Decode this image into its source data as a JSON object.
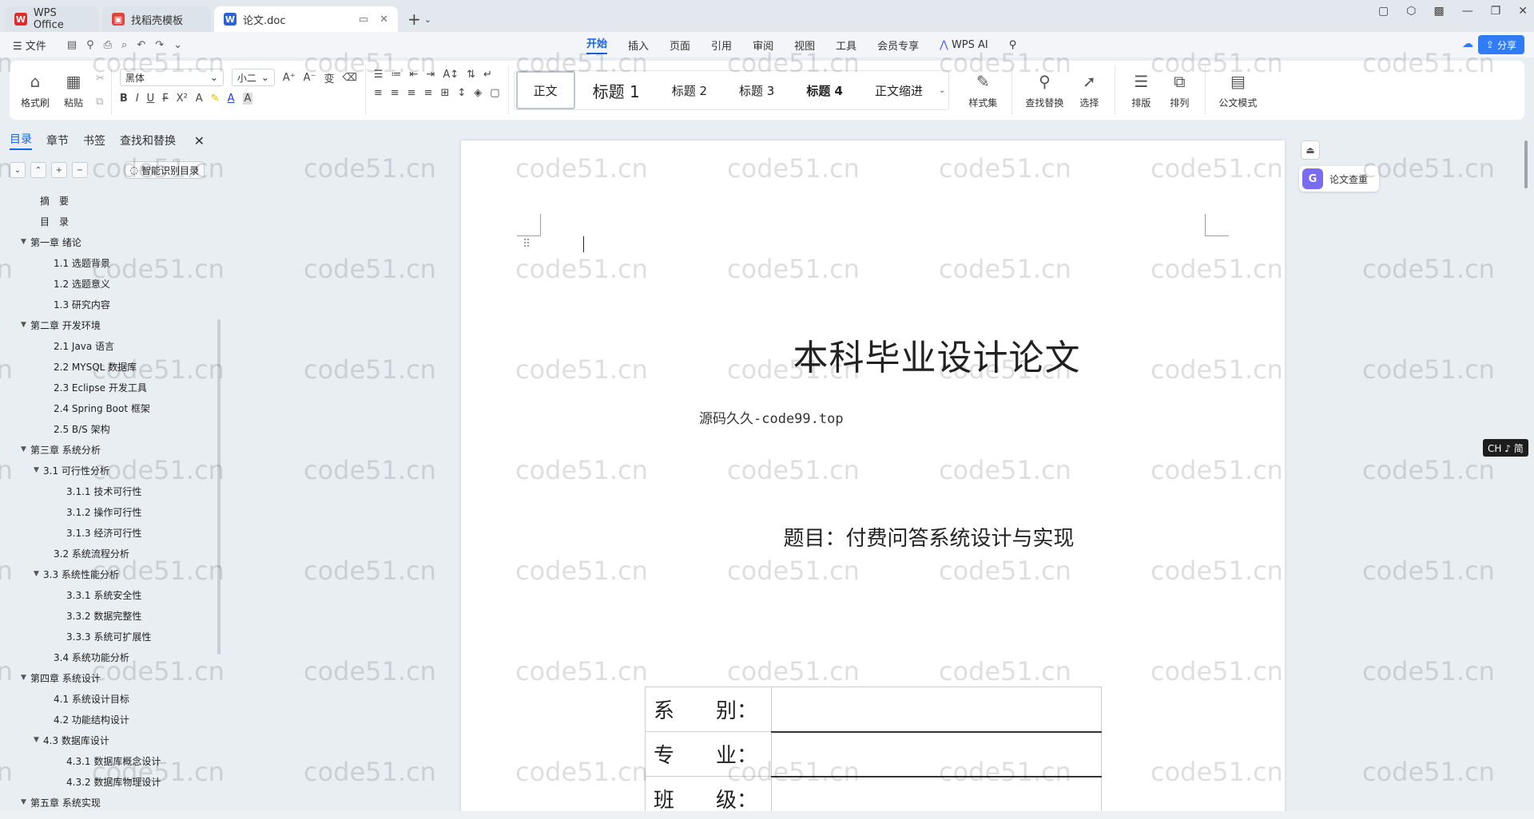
{
  "tabs": [
    {
      "label": "WPS Office"
    },
    {
      "label": "找稻壳模板"
    },
    {
      "label": "论文.doc"
    }
  ],
  "menu": {
    "file": "文件",
    "items": [
      "开始",
      "插入",
      "页面",
      "引用",
      "审阅",
      "视图",
      "工具",
      "会员专享"
    ],
    "wps_ai": "WPS AI",
    "share": "分享"
  },
  "ribbon": {
    "format_painter": "格式刷",
    "paste": "粘贴",
    "font_name": "黑体",
    "font_size": "小二",
    "styles": [
      "正文",
      "标题 1",
      "标题 2",
      "标题 3",
      "标题 4",
      "正文缩进"
    ],
    "style_set": "样式集",
    "find_replace": "查找替换",
    "select": "选择",
    "layout": "排版",
    "arrange": "排列",
    "official_mode": "公文模式"
  },
  "sidebar": {
    "tabs": [
      "目录",
      "章节",
      "书签",
      "查找和替换"
    ],
    "smart_toc": "智能识别目录",
    "toc": [
      {
        "label": "摘　要",
        "level": "lv0",
        "arrow": ""
      },
      {
        "label": "目　录",
        "level": "lv0",
        "arrow": ""
      },
      {
        "label": "第一章 绪论",
        "level": "lv1",
        "arrow": "▼"
      },
      {
        "label": "1.1 选题背景",
        "level": "lv2",
        "arrow": ""
      },
      {
        "label": "1.2 选题意义",
        "level": "lv2",
        "arrow": ""
      },
      {
        "label": "1.3 研究内容",
        "level": "lv2",
        "arrow": ""
      },
      {
        "label": "第二章 开发环境",
        "level": "lv1",
        "arrow": "▼"
      },
      {
        "label": "2.1 Java 语言",
        "level": "lv2",
        "arrow": ""
      },
      {
        "label": "2.2 MYSQL 数据库",
        "level": "lv2",
        "arrow": ""
      },
      {
        "label": "2.3 Eclipse 开发工具",
        "level": "lv2",
        "arrow": ""
      },
      {
        "label": "2.4 Spring Boot 框架",
        "level": "lv2",
        "arrow": ""
      },
      {
        "label": "2.5 B/S 架构",
        "level": "lv2",
        "arrow": ""
      },
      {
        "label": "第三章 系统分析",
        "level": "lv1",
        "arrow": "▼"
      },
      {
        "label": "3.1 可行性分析",
        "level": "lv2a",
        "arrow": "▼"
      },
      {
        "label": "3.1.1 技术可行性",
        "level": "lv3",
        "arrow": ""
      },
      {
        "label": "3.1.2 操作可行性",
        "level": "lv3",
        "arrow": ""
      },
      {
        "label": "3.1.3 经济可行性",
        "level": "lv3",
        "arrow": ""
      },
      {
        "label": "3.2 系统流程分析",
        "level": "lv2",
        "arrow": ""
      },
      {
        "label": "3.3 系统性能分析",
        "level": "lv2a",
        "arrow": "▼"
      },
      {
        "label": "3.3.1 系统安全性",
        "level": "lv3",
        "arrow": ""
      },
      {
        "label": "3.3.2 数据完整性",
        "level": "lv3",
        "arrow": ""
      },
      {
        "label": "3.3.3 系统可扩展性",
        "level": "lv3",
        "arrow": ""
      },
      {
        "label": "3.4 系统功能分析",
        "level": "lv2",
        "arrow": ""
      },
      {
        "label": "第四章 系统设计",
        "level": "lv1",
        "arrow": "▼"
      },
      {
        "label": "4.1 系统设计目标",
        "level": "lv2",
        "arrow": ""
      },
      {
        "label": "4.2 功能结构设计",
        "level": "lv2",
        "arrow": ""
      },
      {
        "label": "4.3 数据库设计",
        "level": "lv2a",
        "arrow": "▼"
      },
      {
        "label": "4.3.1 数据库概念设计",
        "level": "lv3",
        "arrow": ""
      },
      {
        "label": "4.3.2 数据库物理设计",
        "level": "lv3",
        "arrow": ""
      },
      {
        "label": "第五章 系统实现",
        "level": "lv1",
        "arrow": "▼"
      }
    ]
  },
  "document": {
    "title": "本科毕业设计论文",
    "source": "源码久久-code99.top",
    "subject": "题目：付费问答系统设计与实现",
    "fields": [
      {
        "label": "系　　别："
      },
      {
        "label": "专　　业："
      },
      {
        "label": "班　　级："
      }
    ]
  },
  "right_panel": {
    "paper_check": "论文查重",
    "ime": "CH ♪ 简"
  },
  "watermark": "code51.cn"
}
